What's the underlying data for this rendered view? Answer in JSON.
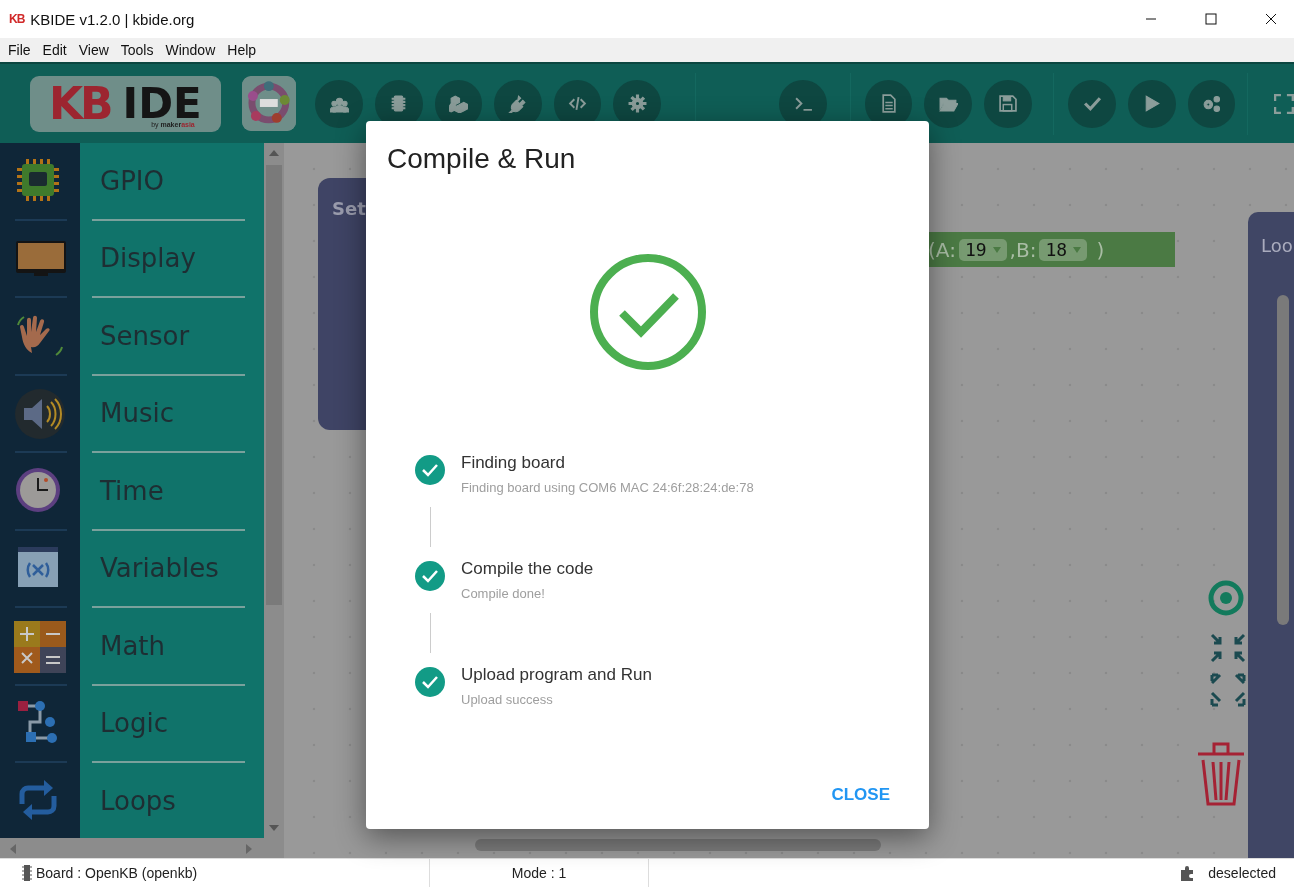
{
  "window": {
    "title": "KBIDE v1.2.0 | kbide.org",
    "app_mark": "KB"
  },
  "menu": [
    "File",
    "Edit",
    "View",
    "Tools",
    "Window",
    "Help"
  ],
  "toolbar": {
    "logo": {
      "mark": "KB",
      "name": "IDE",
      "byline_prefix": "by",
      "byline_brand": "maker",
      "byline_brand_accent": "asia"
    }
  },
  "categories": [
    {
      "label": "GPIO",
      "kind": "chip"
    },
    {
      "label": "Display",
      "kind": "display"
    },
    {
      "label": "Sensor",
      "kind": "hand"
    },
    {
      "label": "Music",
      "kind": "speaker"
    },
    {
      "label": "Time",
      "kind": "clock"
    },
    {
      "label": "Variables",
      "kind": "variable"
    },
    {
      "label": "Math",
      "kind": "math"
    },
    {
      "label": "Logic",
      "kind": "logic"
    },
    {
      "label": "Loops",
      "kind": "loop"
    }
  ],
  "canvas": {
    "set_block": {
      "label": "Set"
    },
    "pin_block": {
      "open": "(A",
      "sep1": ":",
      "a_value": "19",
      "comma": ",B",
      "sep2": ":",
      "b_value": "18",
      "close": ")"
    },
    "loop_block": {
      "label": "Loo"
    }
  },
  "dialog": {
    "title": "Compile & Run",
    "steps": [
      {
        "title": "Finding board",
        "detail": "Finding board using COM6 MAC 24:6f:28:24:de:78",
        "done": true
      },
      {
        "title": "Compile the code",
        "detail": "Compile done!",
        "done": true
      },
      {
        "title": "Upload program and Run",
        "detail": "Upload success",
        "done": true
      }
    ],
    "close": "CLOSE"
  },
  "status_bar": {
    "board": "Board : OpenKB (openkb)",
    "mode": "Mode : 1",
    "selection": "deselected"
  }
}
